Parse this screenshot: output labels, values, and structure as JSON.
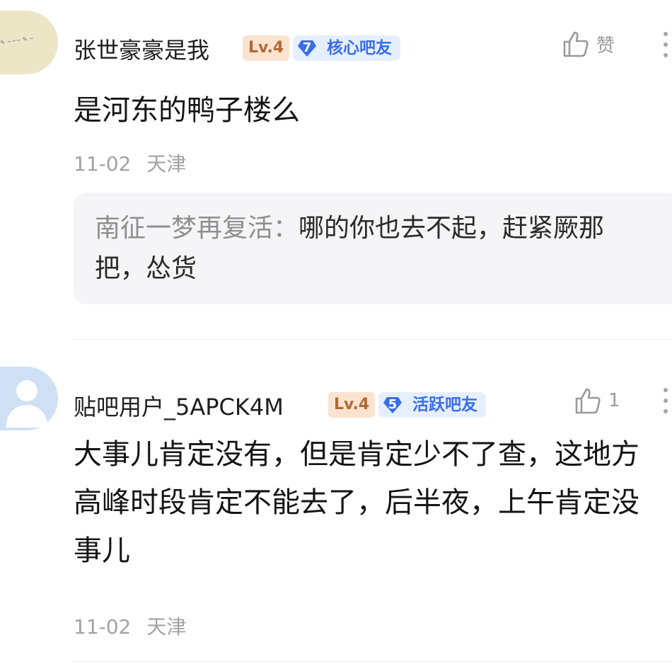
{
  "comments": [
    {
      "username": "张世豪豪是我",
      "level": "Lv.4",
      "rank_number": "7",
      "rank_title": "核心吧友",
      "like_label": "赞",
      "content": "是河东的鸭子楼么",
      "date": "11-02",
      "location": "天津",
      "reply": {
        "author": "南征一梦再复活：",
        "text": "哪的你也去不起，赶紧厥那把，怂货"
      }
    },
    {
      "username": "贴吧用户_5APCK4M",
      "level": "Lv.4",
      "rank_number": "5",
      "rank_title": "活跃吧友",
      "like_label": "1",
      "content": "大事儿肯定没有，但是肯定少不了查，这地方高峰时段肯定不能去了，后半夜，上午肯定没事儿",
      "date": "11-02",
      "location": "天津"
    }
  ],
  "icons": {
    "like": "thumbs-up-icon",
    "more": "more-vertical-icon",
    "rank": "diamond-icon",
    "default_avatar": "default-avatar-icon"
  },
  "colors": {
    "accent_blue": "#3a6ee8",
    "level_badge_bg": "#fbe3cf",
    "level_badge_text": "#b06a35",
    "meta_gray": "#a2a2a2"
  }
}
